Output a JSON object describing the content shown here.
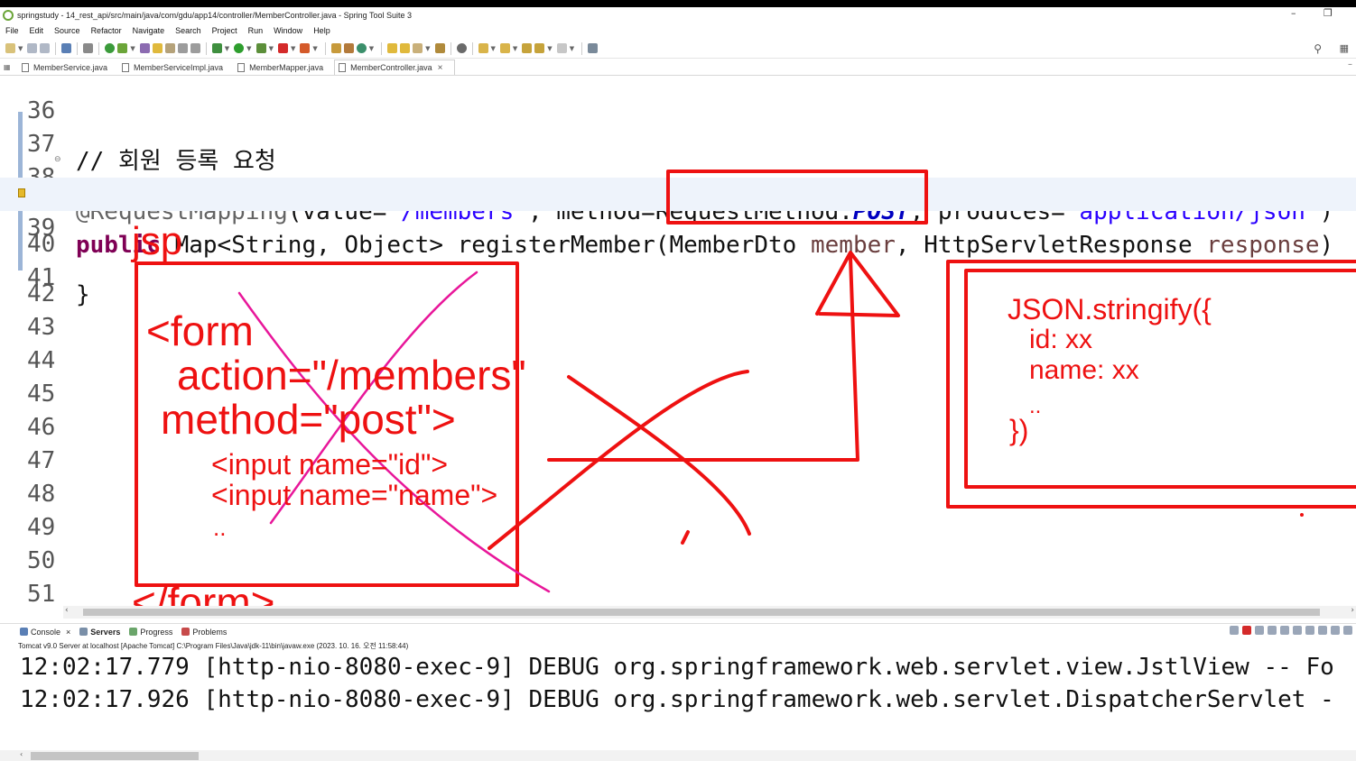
{
  "window": {
    "title": "springstudy - 14_rest_api/src/main/java/com/gdu/app14/controller/MemberController.java - Spring Tool Suite 3",
    "minimize": "–",
    "restore": "❐"
  },
  "menu": [
    "File",
    "Edit",
    "Source",
    "Refactor",
    "Navigate",
    "Search",
    "Project",
    "Run",
    "Window",
    "Help"
  ],
  "tabs": [
    {
      "label": "MemberService.java",
      "active": false
    },
    {
      "label": "MemberServiceImpl.java",
      "active": false
    },
    {
      "label": "MemberMapper.java",
      "active": false
    },
    {
      "label": "MemberController.java",
      "active": true
    }
  ],
  "editor": {
    "line_numbers": [
      "36",
      "37",
      "38",
      "39",
      "40",
      "41",
      "42",
      "43",
      "44",
      "45",
      "46",
      "47",
      "48",
      "49",
      "50",
      "51"
    ],
    "line37_comment": "// 회원 등록 요청",
    "line38": {
      "annotation": "@RequestMapping",
      "open": "(value=",
      "value": "\"/members\"",
      "mid": ", method=RequestMethod.",
      "post": "POST",
      "mid2": ", produces=",
      "produces": "\"application/json\"",
      "close": ")"
    },
    "line39": {
      "kw_public": "public",
      "sig1": " Map<String, Object> registerMember(MemberDto ",
      "param1": "member",
      "sig2": ", HttpServletResponse ",
      "param2": "response",
      "close": ")"
    },
    "line41": "}"
  },
  "annotations": {
    "jsp_label": "jsp",
    "form_lines": [
      "<form",
      "action=\"/members\"",
      "method=\"post\">",
      "<input name=\"id\">",
      "<input name=\"name\">",
      "..",
      "</form>"
    ],
    "json_lines": [
      "JSON.stringify({",
      "id: xx",
      "name: xx",
      "..",
      "})"
    ],
    "ink_color": "#ee1111",
    "pink_color": "#e8179a"
  },
  "console": {
    "tabs": [
      "Console",
      "Servers",
      "Progress",
      "Problems"
    ],
    "server_line": "Tomcat v9.0 Server at localhost [Apache Tomcat] C:\\Program Files\\Java\\jdk-11\\bin\\javaw.exe  (2023. 10. 16. 오전 11:58:44)",
    "lines": [
      "12:02:17.779 [http-nio-8080-exec-9] DEBUG org.springframework.web.servlet.view.JstlView -- Fo",
      "12:02:17.926 [http-nio-8080-exec-9] DEBUG org.springframework.web.servlet.DispatcherServlet -"
    ]
  }
}
